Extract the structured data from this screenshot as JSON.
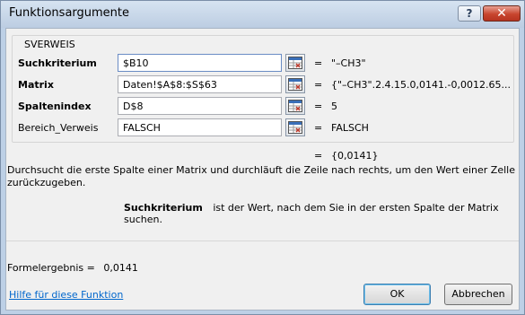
{
  "window": {
    "title": "Funktionsargumente",
    "help_glyph": "?",
    "close_glyph": "✕"
  },
  "function_name": "SVERWEIS",
  "arguments": [
    {
      "label": "Suchkriterium",
      "value": "$B10",
      "result": "\"–CH3\""
    },
    {
      "label": "Matrix",
      "value": "Daten!$A$8:$S$63",
      "result": "{\"–CH3\".2.4.15.0,0141.-0,0012.65..."
    },
    {
      "label": "Spaltenindex",
      "value": "D$8",
      "result": "5"
    },
    {
      "label": "Bereich_Verweis",
      "value": "FALSCH",
      "result": "FALSCH"
    }
  ],
  "equals": "=",
  "function_result": "{0,0141}",
  "description": "Durchsucht die erste Spalte einer Matrix und durchläuft die Zeile nach rechts, um den Wert einer Zelle zurückzugeben.",
  "argument_help": {
    "name": "Suchkriterium",
    "text": "ist der Wert, nach dem Sie in der ersten Spalte der Matrix suchen."
  },
  "formula_result": {
    "label": "Formelergebnis =",
    "value": "0,0141"
  },
  "help_link": "Hilfe für diese Funktion",
  "buttons": {
    "ok": "OK",
    "cancel": "Abbrechen"
  }
}
